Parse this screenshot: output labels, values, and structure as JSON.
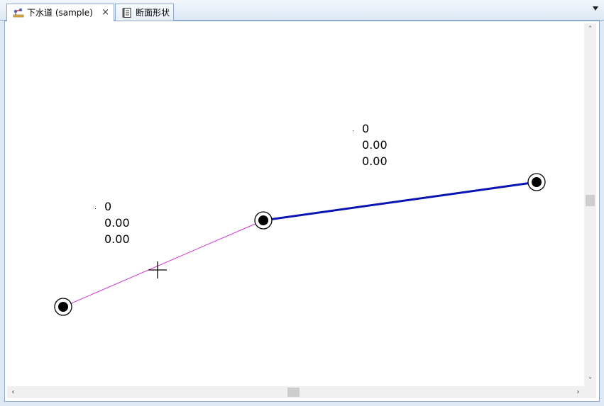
{
  "tabs": [
    {
      "label": "下水道 (sample)",
      "icon": "sewer-network-icon",
      "active": true,
      "close": "×"
    },
    {
      "label": "断面形状",
      "icon": "document-icon",
      "active": false
    }
  ],
  "canvas": {
    "labels": [
      {
        "lines": [
          "0",
          "0.00",
          "0.00"
        ]
      },
      {
        "lines": [
          "0",
          "0.00",
          "0.00"
        ]
      }
    ],
    "colors": {
      "selected_pipe": "#cc33cc",
      "pipe": "#0a14b4",
      "node": "#000000",
      "background": "#ffffff"
    }
  },
  "scrollbars": {
    "up": "˄",
    "down": "˅",
    "left": "‹",
    "right": "›"
  }
}
